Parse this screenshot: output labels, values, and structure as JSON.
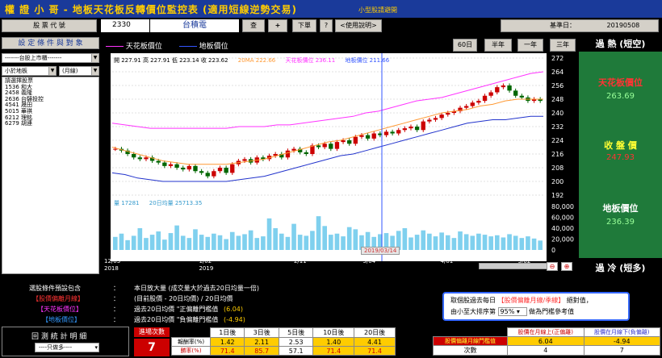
{
  "app": {
    "title": "權 證 小 哥 - 地板天花板反轉價位監控表 (適用短線逆勢交易)",
    "subtitle": "小型股請避開"
  },
  "toolbar": {
    "code_label": "股 票 代 號",
    "stock_code": "2330",
    "stock_name": "台積電",
    "query_btn": "查",
    "add_btn": "+",
    "orders_btn": "下單",
    "help_q": "?",
    "help_btn": "<使用說明>",
    "base_date_label": "基準日：",
    "base_date": "20190508"
  },
  "left": {
    "settings_btn": "設 定 條 件 與 對 象",
    "market_select": "-------台股上市櫃-------",
    "filter_select": "小於地板",
    "period_select": "(月線)",
    "list_title": "請選擇股票",
    "stocks": [
      "1536 和大",
      "2458 義隆",
      "2636 台驊投控",
      "4541 晟田",
      "5015 華祺",
      "6212 理銘",
      "6279 胡連"
    ]
  },
  "chart": {
    "legend_ceiling": "天花板價位",
    "legend_floor": "地板價位",
    "period_buttons": [
      "60日",
      "半年",
      "一年",
      "三年"
    ],
    "ohlc_text": "開 227.91  高 227.91  低 223.14  收 223.62",
    "ma_text": "20MA 222.66",
    "ceiling_text": "天花板價位 236.11",
    "floor_text": "地板價位 211.66",
    "vol_text": "量 17281",
    "vol_ma_text": "20日均量 25713.35",
    "cursor_date": "2019/03/14",
    "x_labels": [
      {
        "l1": "12/03",
        "l2": "2018"
      },
      {
        "l1": "1/02",
        "l2": "2019"
      },
      {
        "l1": "2/11",
        "l2": ""
      },
      {
        "l1": "3/04",
        "l2": ""
      },
      {
        "l1": "4/01",
        "l2": ""
      },
      {
        "l1": "5/02",
        "l2": ""
      }
    ],
    "price_ticks": [
      "272",
      "264",
      "256",
      "248",
      "240",
      "232",
      "224",
      "216",
      "208",
      "200",
      "192"
    ],
    "vol_ticks": [
      "80,000",
      "60,000",
      "40,000",
      "20,000",
      "0"
    ]
  },
  "chart_data": {
    "type": "candlestick",
    "ylim": [
      192,
      272
    ],
    "vol_ylim": [
      0,
      80000
    ],
    "x_start": "2018/12/03",
    "x_end": "2019/05/08",
    "candles_close": [
      219,
      218,
      216,
      214,
      213,
      214,
      212,
      211,
      209,
      210,
      208,
      207,
      209,
      206,
      205,
      203,
      206,
      208,
      205,
      210,
      212,
      213,
      211,
      214,
      213,
      215,
      216,
      214,
      218,
      219,
      217,
      216,
      221,
      220,
      222,
      219,
      223,
      224,
      222,
      226,
      227,
      225,
      228,
      227,
      229,
      228,
      230,
      231,
      232,
      230,
      235,
      236,
      237,
      239,
      240,
      241,
      243,
      244,
      246,
      247,
      250,
      252,
      255,
      256,
      253,
      250,
      249,
      247,
      248,
      247
    ],
    "ceiling_line": [
      234,
      233,
      232,
      231,
      231,
      231,
      231,
      231,
      231,
      231,
      232,
      232,
      232,
      233,
      233,
      234,
      235,
      236,
      237,
      238,
      240,
      241,
      243,
      245,
      247,
      248,
      249,
      251,
      253,
      255,
      257,
      259,
      261,
      263,
      264
    ],
    "ma_line": [
      220,
      218,
      216,
      214,
      212,
      211,
      210,
      210,
      210,
      210,
      211,
      212,
      213,
      215,
      217,
      219,
      221,
      223,
      224,
      226,
      228,
      230,
      232,
      234,
      236,
      238,
      240,
      241,
      242,
      244,
      245,
      247,
      248,
      248,
      248
    ],
    "floor_line": [
      205,
      204,
      202,
      201,
      200,
      200,
      200,
      200,
      200,
      200,
      201,
      202,
      203,
      205,
      207,
      209,
      211,
      213,
      215,
      216,
      218,
      220,
      222,
      224,
      226,
      228,
      230,
      232,
      234,
      235,
      236,
      236,
      237,
      238,
      238
    ],
    "volume": [
      24000,
      30000,
      18000,
      26000,
      40000,
      22000,
      28000,
      34000,
      19000,
      31000,
      45000,
      26000,
      22000,
      38000,
      28000,
      24000,
      30000,
      27000,
      20000,
      33000,
      26000,
      29000,
      36000,
      22000,
      25000,
      58000,
      40000,
      30000,
      24000,
      48000,
      28000,
      26000,
      35000,
      62000,
      44000,
      28000,
      30000,
      25000,
      42000,
      38000,
      27000,
      33000,
      24000,
      29000,
      31000,
      26000,
      35000,
      40000,
      23000,
      28000,
      36000,
      30000,
      25000,
      32000,
      27000,
      22000,
      34000,
      29000,
      26000,
      30000,
      28000,
      25000,
      27000,
      23000,
      29000,
      26000,
      22000,
      25000,
      21000,
      17281
    ]
  },
  "right": {
    "overheat_label": "過 熱 (短空)",
    "ceiling_title": "天花板價位",
    "ceiling_value": "263.69",
    "close_title": "收 盤 價",
    "close_value": "247.93",
    "floor_title": "地板價位",
    "floor_value": "236.39",
    "overcold_label": "過 冷 (短多)"
  },
  "bottom": {
    "preset_label": "選股條件預設包含",
    "colon": "：",
    "cond1": "本日放大量 (成交量大於過去20日均量一倍)",
    "deviation_label": "【股價偏離月線】",
    "cond2": "(目前股價 - 20日均價) / 20日均價",
    "ceiling_label": "【天花板價位】",
    "cond3_pre": "過去20日均價 \"正偏離門檻值",
    "cond3_val": "(6.04)",
    "floor_label": "【地板價位】",
    "cond4_pre": "過去20日均價 \"負偏離門檻值",
    "cond4_val": "(-4.94)",
    "note_l1_a": "取個股過去每日",
    "note_l1_b": "【股價偏離月線/季線】",
    "note_l1_c": "絕對值，",
    "note_l2_a": "由小至大排序第",
    "note_pct": "95%",
    "note_l2_b": "做為門檻參考值",
    "backtest_title": "回 測 統 計 明 細",
    "backtest_select": "----只做多----",
    "entry_count_label": "進場次數",
    "entry_count": "7",
    "days": [
      "1日後",
      "3日後",
      "5日後",
      "10日後",
      "20日後"
    ],
    "return_label": "報酬率(%)",
    "returns": [
      "1.42",
      "2.11",
      "2.53",
      "1.40",
      "4.41"
    ],
    "win_label": "勝率(%)",
    "wins": [
      "71.4",
      "85.7",
      "57.1",
      "71.4",
      "71.4"
    ],
    "thr_head_pos": "股價在月線上(正偏離)",
    "thr_head_neg": "股價在月線下(負偏離)",
    "thr_row_label": "股價偏離月線門檻值",
    "thr_pos": "6.04",
    "thr_neg": "-4.94",
    "count_label": "次數",
    "count_pos": "4",
    "count_neg": "7"
  }
}
